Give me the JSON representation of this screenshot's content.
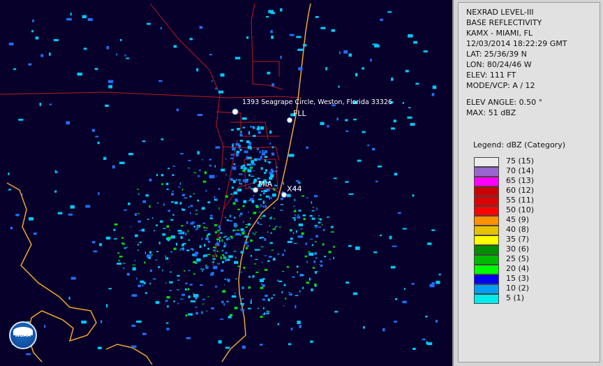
{
  "map": {
    "labels": {
      "address": "1393 Seagrape Circle, Weston, Florida 33326",
      "fll": "FLL",
      "mia": "MIA",
      "x44": "X44"
    },
    "colors": {
      "background": "#06002b",
      "coastline": "#f2a52a",
      "roads": "#c0171b",
      "echo_light": "#00c8ff",
      "echo_mid": "#1f6fff",
      "echo_green": "#00e000"
    },
    "logo": "noaa-logo",
    "logo_text": "NOAA"
  },
  "panel": {
    "product": "NEXRAD LEVEL-III",
    "product_type": "BASE REFLECTIVITY",
    "station": "KAMX - MIAMI, FL",
    "datetime": "12/03/2014 18:22:29 GMT",
    "lat": "LAT: 25/36/39 N",
    "lon": "LON: 80/24/46 W",
    "elev": "ELEV: 111 FT",
    "mode": "MODE/VCP: A / 12",
    "elev_angle": "ELEV ANGLE: 0.50 °",
    "max": "MAX: 51 dBZ",
    "legend_title": "Legend: dBZ (Category)",
    "legend": [
      {
        "label": "75  (15)",
        "color": "#ececec"
      },
      {
        "label": "70  (14)",
        "color": "#9966cc"
      },
      {
        "label": "65  (13)",
        "color": "#ff00ff"
      },
      {
        "label": "60  (12)",
        "color": "#cc0000"
      },
      {
        "label": "55  (11)",
        "color": "#dd0000"
      },
      {
        "label": "50  (10)",
        "color": "#ff0000"
      },
      {
        "label": "45  (9)",
        "color": "#ff9000"
      },
      {
        "label": "40  (8)",
        "color": "#e7c000"
      },
      {
        "label": "35  (7)",
        "color": "#ffff00"
      },
      {
        "label": "30  (6)",
        "color": "#008e00"
      },
      {
        "label": "25  (5)",
        "color": "#00b800"
      },
      {
        "label": "20  (4)",
        "color": "#00ff00"
      },
      {
        "label": "15  (3)",
        "color": "#0000f5"
      },
      {
        "label": "10  (2)",
        "color": "#009ff5"
      },
      {
        "label": "5  (1)",
        "color": "#00ecec"
      }
    ]
  }
}
